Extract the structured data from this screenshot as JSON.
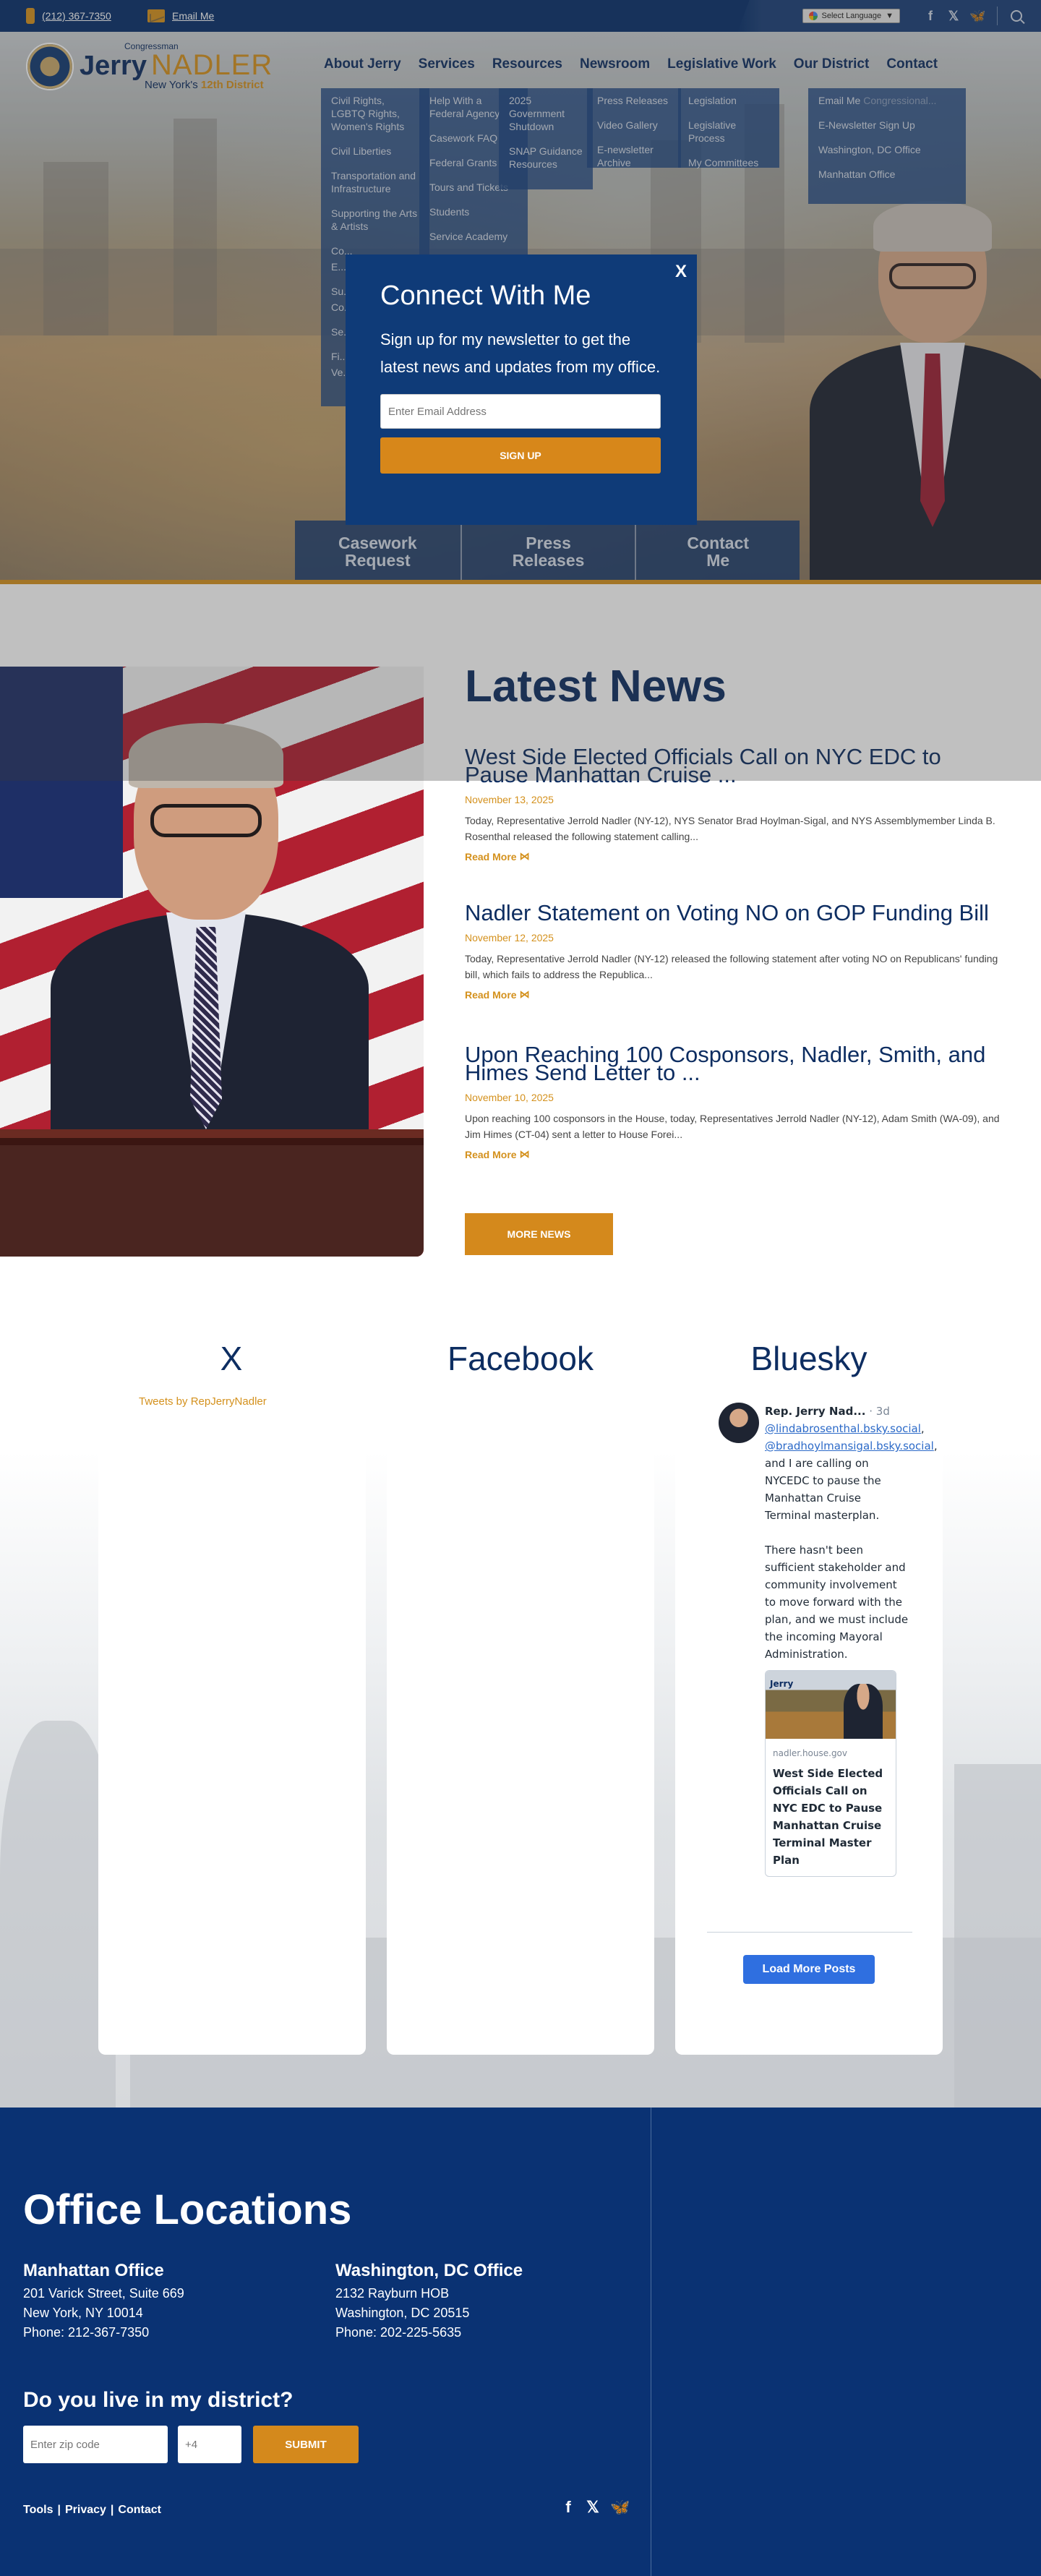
{
  "topbar": {
    "phone": "(212) 367-7350",
    "email_label": "Email Me",
    "language_label": "Select Language",
    "social_icons": [
      "facebook-icon",
      "x-icon",
      "bluesky-icon"
    ]
  },
  "logo": {
    "prefix": "Congressman",
    "first_name": "Jerry",
    "last_name": "NADLER",
    "district_prefix": "New York's ",
    "district_bold": "12th District"
  },
  "nav": {
    "items": [
      "About Jerry",
      "Services",
      "Resources",
      "Newsroom",
      "Legislative Work",
      "Our District",
      "Contact"
    ]
  },
  "dropdowns": {
    "legislative_work": [
      "Civil Rights, LGBTQ Rights, Women's Rights",
      "Civil Liberties",
      "Transportation and Infrastructure",
      "Supporting the Arts & Artists",
      "Co...",
      "E...",
      "Su...",
      "Co...",
      "Se...",
      "Fi...",
      "Ve..."
    ],
    "services": [
      "Help With a Federal Agency",
      "Casework FAQ",
      "Federal Grants",
      "Tours and Tickets",
      "Students",
      "Service Academy"
    ],
    "resources": [
      "2025 Government Shutdown",
      "SNAP Guidance Resources"
    ],
    "newsroom": [
      "Press Releases",
      "Video Gallery",
      "E-newsletter Archive"
    ],
    "legislative": [
      "Legislation",
      "Legislative Process",
      "My Committees"
    ],
    "contact": [
      "Email Me",
      "E-Newsletter Sign Up",
      "Washington, DC Office",
      "Manhattan Office"
    ],
    "our_district_extra": "Congressional..."
  },
  "hero_buttons": [
    "Casework Request",
    "Press Releases",
    "Contact Me"
  ],
  "modal": {
    "title": "Connect With Me",
    "text": "Sign up for my newsletter to get the latest news and updates from my office.",
    "email_placeholder": "Enter Email Address",
    "submit_label": "SIGN UP",
    "close_label": "X"
  },
  "news": {
    "section_title": "Latest News",
    "items": [
      {
        "title": "West Side Elected Officials Call on NYC EDC to Pause Manhattan Cruise ...",
        "date": "November 13, 2025",
        "excerpt": "Today, Representative Jerrold Nadler (NY-12), NYS Senator Brad Hoylman-Sigal, and NYS Assemblymember Linda B. Rosenthal released the following statement calling...",
        "read_more": "Read More"
      },
      {
        "title": "Nadler Statement on Voting NO on GOP Funding Bill",
        "date": "November 12, 2025",
        "excerpt": "Today, Representative Jerrold Nadler (NY-12) released the following statement after voting NO on Republicans' funding bill, which fails to address the Republica...",
        "read_more": "Read More"
      },
      {
        "title": "Upon Reaching 100 Cosponsors, Nadler, Smith, and Himes Send Letter to ...",
        "date": "November 10, 2025",
        "excerpt": "Upon reaching 100 cosponsors in the House, today, Representatives Jerrold Nadler (NY-12), Adam Smith (WA-09), and Jim Himes (CT-04) sent a letter to House Forei...",
        "read_more": "Read More"
      }
    ],
    "more_label": "MORE NEWS"
  },
  "social": {
    "headings": [
      "X",
      "Facebook",
      "Bluesky"
    ],
    "tweets_link": "Tweets by RepJerryNadler",
    "bluesky": {
      "author": "Rep. Jerry Nad...",
      "time": "· 3d",
      "mention1": "@lindabrosenthal.bsky.social",
      "mention2": "@bradhoylmansigal.bsky.social",
      "text1": "and I are calling on NYCEDC to pause the Manhattan Cruise Terminal masterplan.",
      "text2": "There hasn't been sufficient stakeholder and community involvement to move forward with the plan, and we must include the incoming Mayoral Administration.",
      "card_domain": "nadler.house.gov",
      "card_title": "West Side Elected Officials Call on NYC EDC to Pause Manhattan Cruise Terminal Master Plan",
      "load_more": "Load More Posts"
    }
  },
  "footer": {
    "title": "Office Locations",
    "offices": [
      {
        "name": "Manhattan Office",
        "lines": [
          "201 Varick Street, Suite 669",
          "New York, NY 10014",
          "Phone: 212-367-7350"
        ]
      },
      {
        "name": "Washington, DC Office",
        "lines": [
          "2132 Rayburn HOB",
          "Washington, DC 20515",
          "Phone: 202-225-5635"
        ]
      }
    ],
    "district_title": "Do you live in my district?",
    "zip_placeholder": "Enter zip code",
    "plus4_placeholder": "+4",
    "submit_label": "SUBMIT",
    "links": [
      "Tools",
      "|",
      "Privacy",
      "|",
      "Contact"
    ],
    "social_icons": [
      "facebook-icon",
      "x-icon",
      "bluesky-icon"
    ]
  },
  "colors": {
    "navy": "#0d2d61",
    "gold": "#d4911d",
    "footer_bg": "#0a3273",
    "modal_bg": "#0f3b78"
  }
}
